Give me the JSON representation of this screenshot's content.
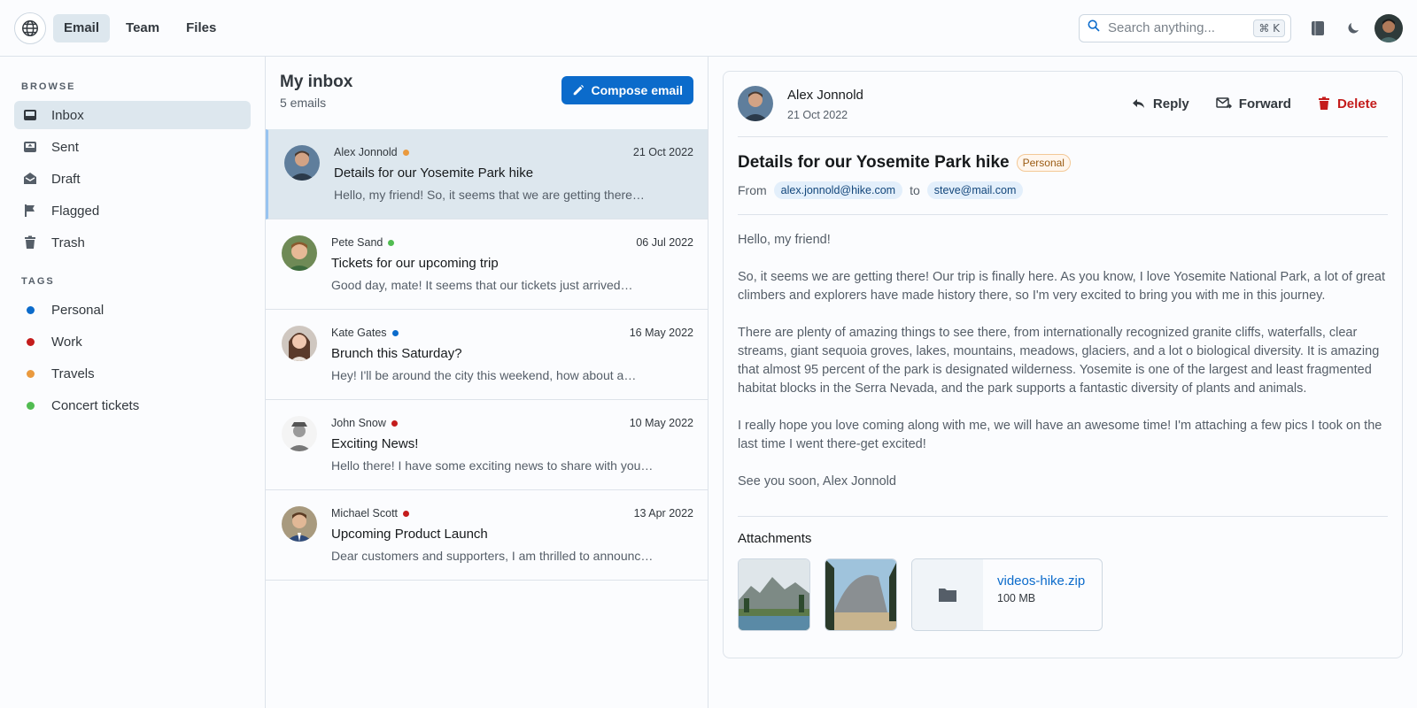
{
  "header": {
    "tabs": [
      {
        "label": "Email",
        "active": true
      },
      {
        "label": "Team",
        "active": false
      },
      {
        "label": "Files",
        "active": false
      }
    ],
    "search": {
      "placeholder": "Search anything...",
      "shortcut": "⌘ K"
    },
    "icons": [
      "globe-icon",
      "book-icon",
      "moon-icon",
      "user-avatar"
    ]
  },
  "sidebar": {
    "browse_label": "BROWSE",
    "browse": [
      {
        "label": "Inbox",
        "icon": "inbox-icon",
        "active": true
      },
      {
        "label": "Sent",
        "icon": "sent-icon",
        "active": false
      },
      {
        "label": "Draft",
        "icon": "draft-icon",
        "active": false
      },
      {
        "label": "Flagged",
        "icon": "flag-icon",
        "active": false
      },
      {
        "label": "Trash",
        "icon": "trash-icon",
        "active": false
      }
    ],
    "tags_label": "TAGS",
    "tags": [
      {
        "label": "Personal",
        "color": "#0b6bcb"
      },
      {
        "label": "Work",
        "color": "#c41c1c"
      },
      {
        "label": "Travels",
        "color": "#ea9a3e"
      },
      {
        "label": "Concert tickets",
        "color": "#51bc51"
      }
    ]
  },
  "list": {
    "title": "My inbox",
    "count": "5 emails",
    "compose_label": "Compose email",
    "emails": [
      {
        "sender": "Alex Jonnold",
        "dot": "#ea9a3e",
        "date": "21 Oct 2022",
        "subject": "Details for our Yosemite Park hike",
        "preview": "Hello, my friend! So, it seems that we are getting there…"
      },
      {
        "sender": "Pete Sand",
        "dot": "#51bc51",
        "date": "06 Jul 2022",
        "subject": "Tickets for our upcoming trip",
        "preview": "Good day, mate! It seems that our tickets just arrived…"
      },
      {
        "sender": "Kate Gates",
        "dot": "#0b6bcb",
        "date": "16 May 2022",
        "subject": "Brunch this Saturday?",
        "preview": "Hey! I'll be around the city this weekend, how about a…"
      },
      {
        "sender": "John Snow",
        "dot": "#c41c1c",
        "date": "10 May 2022",
        "subject": "Exciting News!",
        "preview": "Hello there! I have some exciting news to share with you…"
      },
      {
        "sender": "Michael Scott",
        "dot": "#c41c1c",
        "date": "13 Apr 2022",
        "subject": "Upcoming Product Launch",
        "preview": "Dear customers and supporters, I am thrilled to announc…"
      }
    ]
  },
  "reader": {
    "sender": "Alex Jonnold",
    "date": "21 Oct 2022",
    "actions": {
      "reply": "Reply",
      "forward": "Forward",
      "delete": "Delete"
    },
    "subject": "Details for our Yosemite Park hike",
    "tag": "Personal",
    "from_label": "From",
    "from": "alex.jonnold@hike.com",
    "to_label": "to",
    "to": "steve@mail.com",
    "body": [
      "Hello, my friend!",
      "So, it seems we are getting there! Our trip is finally here. As you know, I love Yosemite National Park, a lot of great climbers and explorers have made history there, so I'm very excited to bring you with me in this journey.",
      "There are plenty of amazing things to see there, from internationally recognized granite cliffs, waterfalls, clear streams, giant sequoia groves, lakes, mountains, meadows, glaciers, and a lot o biological diversity. It is amazing that almost 95 percent of the park is designated wilderness. Yosemite is one of the largest and least fragmented habitat blocks in the Serra Nevada, and the park supports a fantastic diversity of plants and animals.",
      "I really hope you love coming along with me, we will have an awesome time! I'm attaching a few pics I took on the last time I went there-get excited!",
      "See you soon, Alex Jonnold"
    ],
    "attachments_label": "Attachments",
    "file": {
      "name": "videos-hike.zip",
      "size": "100 MB"
    }
  }
}
